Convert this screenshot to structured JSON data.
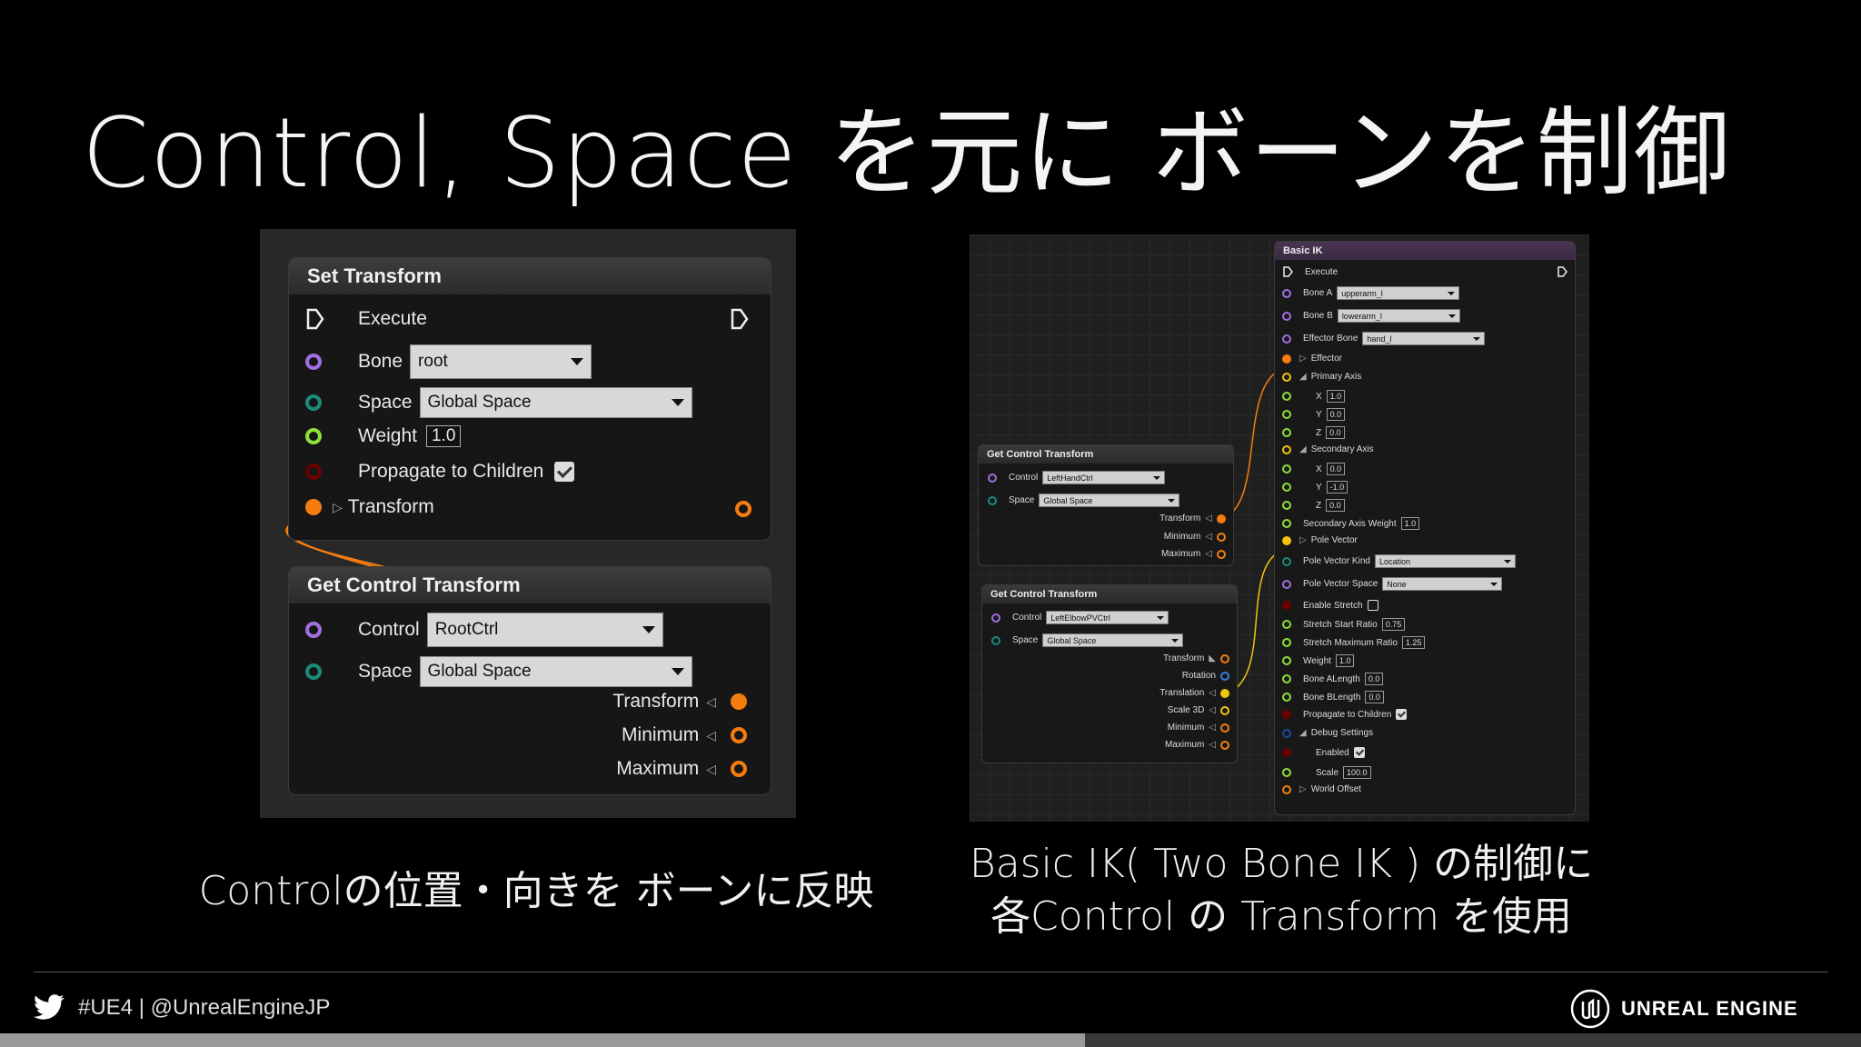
{
  "slide": {
    "title": "Control, Space を元に ボーンを制御"
  },
  "left_panel": {
    "set_transform": {
      "title": "Set Transform",
      "execute_label": "Execute",
      "bone_label": "Bone",
      "bone_value": "root",
      "space_label": "Space",
      "space_value": "Global Space",
      "weight_label": "Weight",
      "weight_value": "1.0",
      "propagate_label": "Propagate to Children",
      "transform_label": "Transform"
    },
    "get_control_transform": {
      "title": "Get Control Transform",
      "control_label": "Control",
      "control_value": "RootCtrl",
      "space_label": "Space",
      "space_value": "Global Space",
      "transform_label": "Transform",
      "minimum_label": "Minimum",
      "maximum_label": "Maximum"
    }
  },
  "right_panel": {
    "get_control_1": {
      "title": "Get Control Transform",
      "control_label": "Control",
      "control_value": "LeftHandCtrl",
      "space_label": "Space",
      "space_value": "Global Space",
      "outputs": [
        "Transform",
        "Minimum",
        "Maximum"
      ]
    },
    "get_control_2": {
      "title": "Get Control Transform",
      "control_label": "Control",
      "control_value": "LeftElbowPVCtrl",
      "space_label": "Space",
      "space_value": "Global Space",
      "outputs": [
        "Transform",
        "Rotation",
        "Translation",
        "Scale 3D",
        "Minimum",
        "Maximum"
      ]
    },
    "basic_ik": {
      "title": "Basic IK",
      "execute_label": "Execute",
      "bone_a_label": "Bone A",
      "bone_a_value": "upperarm_l",
      "bone_b_label": "Bone B",
      "bone_b_value": "lowerarm_l",
      "effector_bone_label": "Effector Bone",
      "effector_bone_value": "hand_l",
      "effector_label": "Effector",
      "primary_axis_label": "Primary Axis",
      "primary_axis": {
        "x": "1.0",
        "y": "0.0",
        "z": "0.0"
      },
      "secondary_axis_label": "Secondary Axis",
      "secondary_axis": {
        "x": "0.0",
        "y": "-1.0",
        "z": "0.0"
      },
      "secondary_axis_weight_label": "Secondary Axis Weight",
      "secondary_axis_weight_value": "1.0",
      "pole_vector_label": "Pole Vector",
      "pole_vector_kind_label": "Pole Vector Kind",
      "pole_vector_kind_value": "Location",
      "pole_vector_space_label": "Pole Vector Space",
      "pole_vector_space_value": "None",
      "enable_stretch_label": "Enable Stretch",
      "stretch_start_ratio_label": "Stretch Start Ratio",
      "stretch_start_ratio_value": "0.75",
      "stretch_max_ratio_label": "Stretch Maximum Ratio",
      "stretch_max_ratio_value": "1.25",
      "weight_label": "Weight",
      "weight_value": "1.0",
      "bone_a_length_label": "Bone ALength",
      "bone_a_length_value": "0.0",
      "bone_b_length_label": "Bone BLength",
      "bone_b_length_value": "0.0",
      "propagate_label": "Propagate to Children",
      "debug_settings_label": "Debug Settings",
      "enabled_label": "Enabled",
      "scale_label": "Scale",
      "scale_value": "100.0",
      "world_offset_label": "World Offset"
    }
  },
  "captions": {
    "left": "Controlの位置・向きを ボーンに反映",
    "right_line1": "Basic IK( Two Bone IK ) の制御に",
    "right_line2": "各Control の Transform を使用"
  },
  "footer": {
    "hashtag": "#UE4 | @UnrealEngineJP",
    "brand": "UNREAL ENGINE",
    "progress": 0.583
  },
  "colors": {
    "exec": "#ffffff",
    "bone_pin": "#a070e0",
    "space_pin": "#1a8a7a",
    "float_pin": "#8ee038",
    "bool_pin": "#8a0000",
    "transform_pin": "#f57d10",
    "vector_pin": "#f2c40c"
  }
}
